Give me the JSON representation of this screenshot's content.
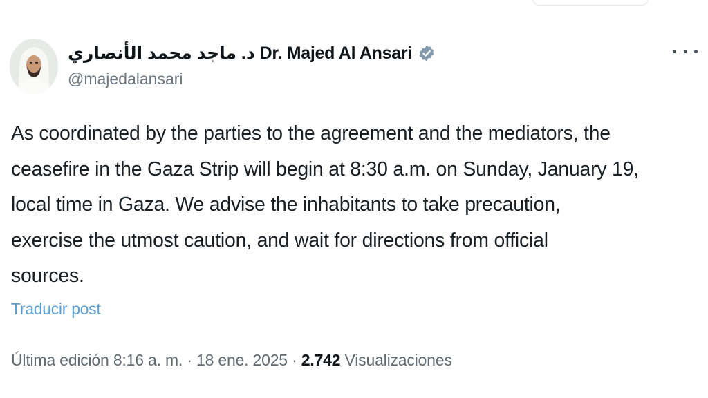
{
  "author": {
    "display_name": "د. ماجد محمد الأنصاري Dr. Majed Al Ansari",
    "handle": "@majedalansari",
    "verified": true
  },
  "tweet": {
    "text_lines": [
      "As coordinated by the parties to the agreement and the mediators, the",
      "ceasefire in the Gaza Strip will begin at 8:30 a.m. on Sunday,  January 19,",
      "local time in Gaza. We advise the inhabitants to take precaution,",
      "exercise the utmost caution, and wait for directions from official",
      "sources."
    ],
    "translate_label": "Traducir post"
  },
  "meta": {
    "edited_label": "Última edición 8:16 a. m.",
    "sep1": "·",
    "date": "18 ene. 2025",
    "sep2": "·",
    "views_count": "2.742",
    "views_label": "Visualizaciones"
  },
  "colors": {
    "verified_badge": "#829aab",
    "link": "#5b9fd6",
    "secondary_text": "#6b7680"
  },
  "icons": {
    "verified": "verified-badge-icon",
    "more": "more-options-icon"
  }
}
